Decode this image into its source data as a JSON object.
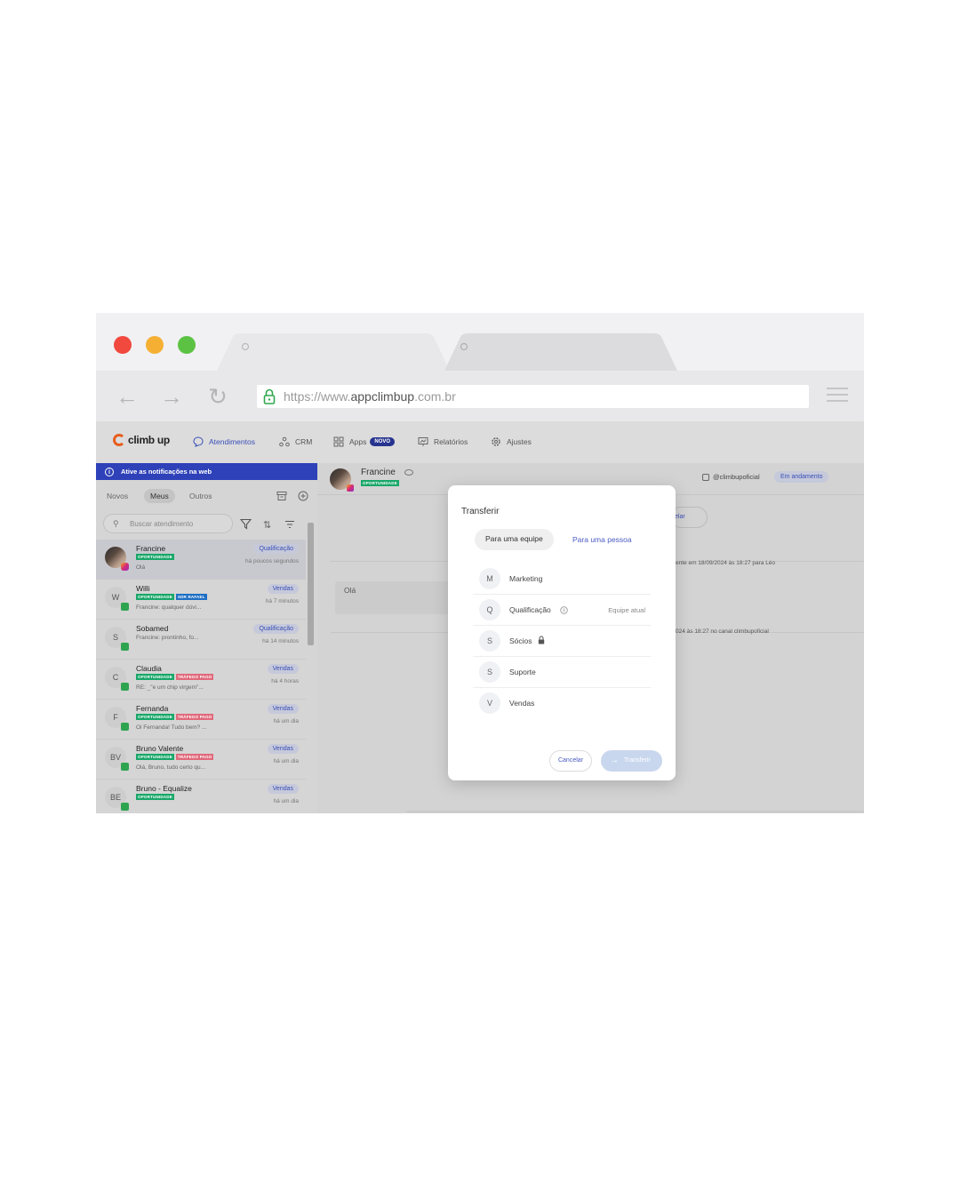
{
  "browser": {
    "url_prefix": "https://www.",
    "url_domain": "appclimbup",
    "url_suffix": ".com.br",
    "nav": {
      "back": "←",
      "forward": "→",
      "reload": "↻"
    }
  },
  "app": {
    "logo": "climb up",
    "nav": {
      "atendimentos": "Atendimentos",
      "crm": "CRM",
      "apps": "Apps",
      "novo_badge": "NOVO",
      "relatorios": "Relatórios",
      "ajustes": "Ajustes"
    },
    "accent_color": "#3b4fb8",
    "brand_color": "#e85d1c"
  },
  "sidebar": {
    "notification": "Ative as notificações na web",
    "tabs": [
      "Novos",
      "Meus",
      "Outros"
    ],
    "active_tab": "Meus",
    "search_placeholder": "Buscar atendimento",
    "conversations": [
      {
        "name": "Francine",
        "initials": "",
        "tags": [
          "OPORTUNIDADE"
        ],
        "message": "Olá",
        "team": "Qualificação",
        "time": "há poucos segundos",
        "channel": "instagram"
      },
      {
        "name": "Willi",
        "initials": "W",
        "tags": [
          "OPORTUNIDADE",
          "SDR RAFAEL"
        ],
        "message": "Francine: qualquer dúvi...",
        "team": "Vendas",
        "time": "há 7 minutos",
        "channel": "whatsapp"
      },
      {
        "name": "Sobamed",
        "initials": "S",
        "tags": [],
        "message": "Francine: prontinho, fo...",
        "team": "Qualificação",
        "time": "há 14 minutos",
        "channel": "whatsapp"
      },
      {
        "name": "Claudia",
        "initials": "C",
        "tags": [
          "OPORTUNIDADE",
          "TRÁFEGO PAGO"
        ],
        "message": "RE: _\"e um chip virgem\"...",
        "team": "Vendas",
        "time": "há 4 horas",
        "channel": "whatsapp"
      },
      {
        "name": "Fernanda",
        "initials": "F",
        "tags": [
          "OPORTUNIDADE",
          "TRÁFEGO PAGO"
        ],
        "message": "Oi Fernanda! Tudo bem? ...",
        "team": "Vendas",
        "time": "há um dia",
        "channel": "whatsapp"
      },
      {
        "name": "Bruno Valente",
        "initials": "BV",
        "tags": [
          "OPORTUNIDADE",
          "TRÁFEGO PAGO"
        ],
        "message": "Olá, Bruno, tudo certo qu...",
        "team": "Vendas",
        "time": "há um dia",
        "channel": "whatsapp"
      },
      {
        "name": "Bruno - Equalize",
        "initials": "BE",
        "tags": [
          "OPORTUNIDADE"
        ],
        "message": "",
        "team": "Vendas",
        "time": "há um dia",
        "channel": "whatsapp"
      }
    ]
  },
  "chat": {
    "contact_name": "Francine",
    "contact_tag": "OPORTUNIDADE",
    "instagram_handle": "@climbupoficial",
    "status": "Em andamento",
    "pill_behind_text": "elar",
    "system_line_1": "ente em 18/09/2024 às 18:27 para Léo",
    "system_line_2": "024 às 18:27 no canal climbupoficial",
    "message": "Olá"
  },
  "modal": {
    "title": "Transferir",
    "segment_team": "Para uma equipe",
    "segment_person": "Para uma pessoa",
    "teams": [
      {
        "initial": "M",
        "name": "Marketing",
        "note": ""
      },
      {
        "initial": "Q",
        "name": "Qualificação",
        "note": "Equipe atual"
      },
      {
        "initial": "S",
        "name": "Sócios",
        "note": ""
      },
      {
        "initial": "S",
        "name": "Suporte",
        "note": ""
      },
      {
        "initial": "V",
        "name": "Vendas",
        "note": ""
      }
    ],
    "cancel": "Cancelar",
    "transfer": "Transferir"
  }
}
